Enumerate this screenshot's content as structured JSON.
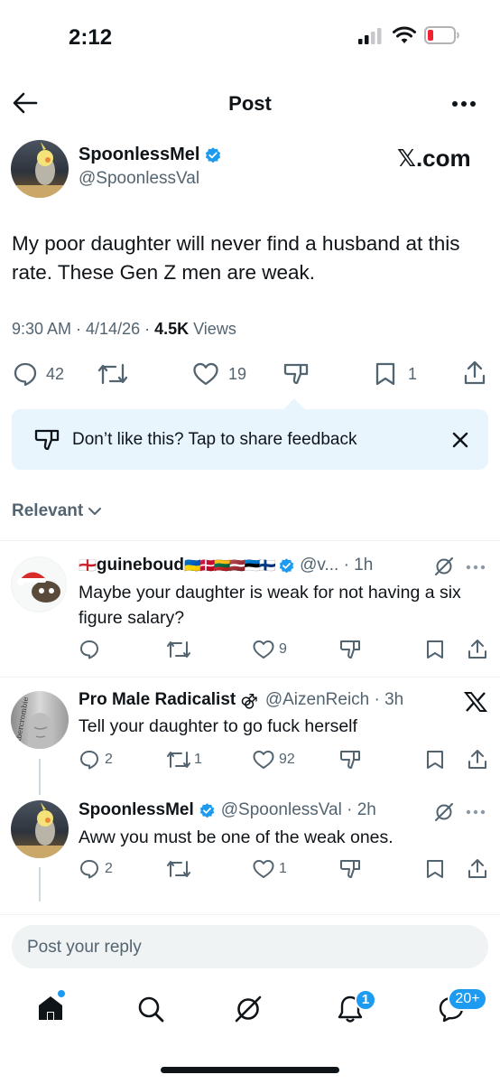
{
  "status_bar": {
    "time": "2:12"
  },
  "header": {
    "title": "Post"
  },
  "post": {
    "display_name": "SpoonlessMel",
    "handle": "@SpoonlessVal",
    "watermark": "𝕏.com",
    "text": "My poor daughter will never find a husband at this rate. These Gen Z men are weak.",
    "timestamp": "9:30 AM · 4/14/26 · ",
    "views_count": "4.5K",
    "views_label": " Views",
    "replies": "42",
    "likes": "19",
    "bookmarks": "1"
  },
  "feedback_banner": {
    "text": "Don’t like this? Tap to share feedback"
  },
  "sort": {
    "label": "Relevant"
  },
  "replies": [
    {
      "flag_prefix": "🏴󠁧󠁢󠁥󠁮󠁧󠁿",
      "display_name": "guineboud",
      "flags": "🇺🇦🇩🇰🇱🇹🇱🇻🇪🇪🇫🇮",
      "handle": "@v... · 1h",
      "text": "Maybe your daughter is weak for not having a six figure salary?",
      "likes": "9"
    },
    {
      "display_name": "Pro Male Radicalist",
      "symbol": "⚣",
      "handle": "@AizenReich · 3h",
      "text": "Tell your daughter to go fuck herself",
      "replies": "2",
      "reposts": "1",
      "likes": "92",
      "avatar_text": "Abercrombie"
    },
    {
      "display_name": "SpoonlessMel",
      "handle": "@SpoonlessVal · 2h",
      "text": "Aww you must be one of the weak ones.",
      "replies": "2",
      "likes": "1"
    }
  ],
  "reply_box": {
    "placeholder": "Post your reply"
  },
  "bottom_nav": {
    "notifications_badge": "1",
    "messages_badge": "20+"
  },
  "colors": {
    "accent": "#1d9bf0",
    "text": "#0f1419",
    "secondary": "#536471",
    "banner_bg": "#e8f5fd",
    "battery_red": "#f4212e"
  }
}
